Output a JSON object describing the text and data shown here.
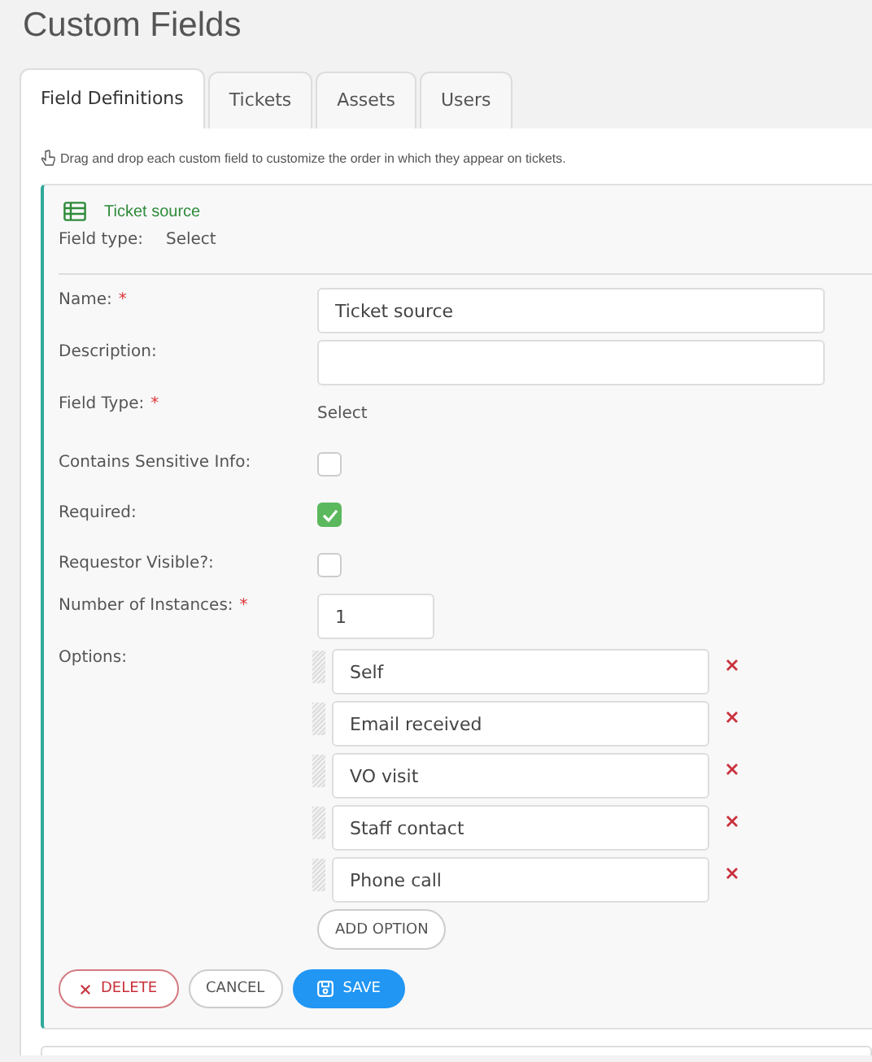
{
  "title": "Custom Fields",
  "tabs": [
    {
      "label": "Field Definitions",
      "selected": true
    },
    {
      "label": "Tickets",
      "selected": false
    },
    {
      "label": "Assets",
      "selected": false
    },
    {
      "label": "Users",
      "selected": false
    }
  ],
  "hint": "Drag and drop each custom field to customize the order in which they appear on tickets.",
  "card": {
    "name": "Ticket source",
    "field_type_label": "Field type:",
    "field_type_value": "Select",
    "rows": [
      {
        "kind": "input",
        "label": "Name:",
        "required_mark": "*",
        "value": "Ticket source"
      },
      {
        "kind": "input",
        "label": "Description:"
      },
      {
        "kind": "text",
        "label": "Field Type:",
        "required_mark": "*",
        "value": "Select"
      },
      {
        "kind": "checkbox",
        "label": "Contains Sensitive Info:",
        "checked": false
      },
      {
        "kind": "checkbox",
        "label": "Required:",
        "checked": true
      },
      {
        "kind": "checkbox",
        "label": "Requestor Visible?:",
        "checked": false
      },
      {
        "kind": "number",
        "label": "Number of Instances:",
        "required_mark": "*",
        "value": "1"
      },
      {
        "kind": "options",
        "label": "Options:",
        "options": [
          "Self",
          "Email received",
          "VO visit",
          "Staff contact",
          "Phone call"
        ],
        "add_label": "ADD OPTION"
      }
    ],
    "buttons": [
      {
        "kind": "delete",
        "label": "DELETE"
      },
      {
        "kind": "cancel",
        "label": "CANCEL"
      },
      {
        "kind": "save",
        "label": "SAVE"
      }
    ]
  }
}
